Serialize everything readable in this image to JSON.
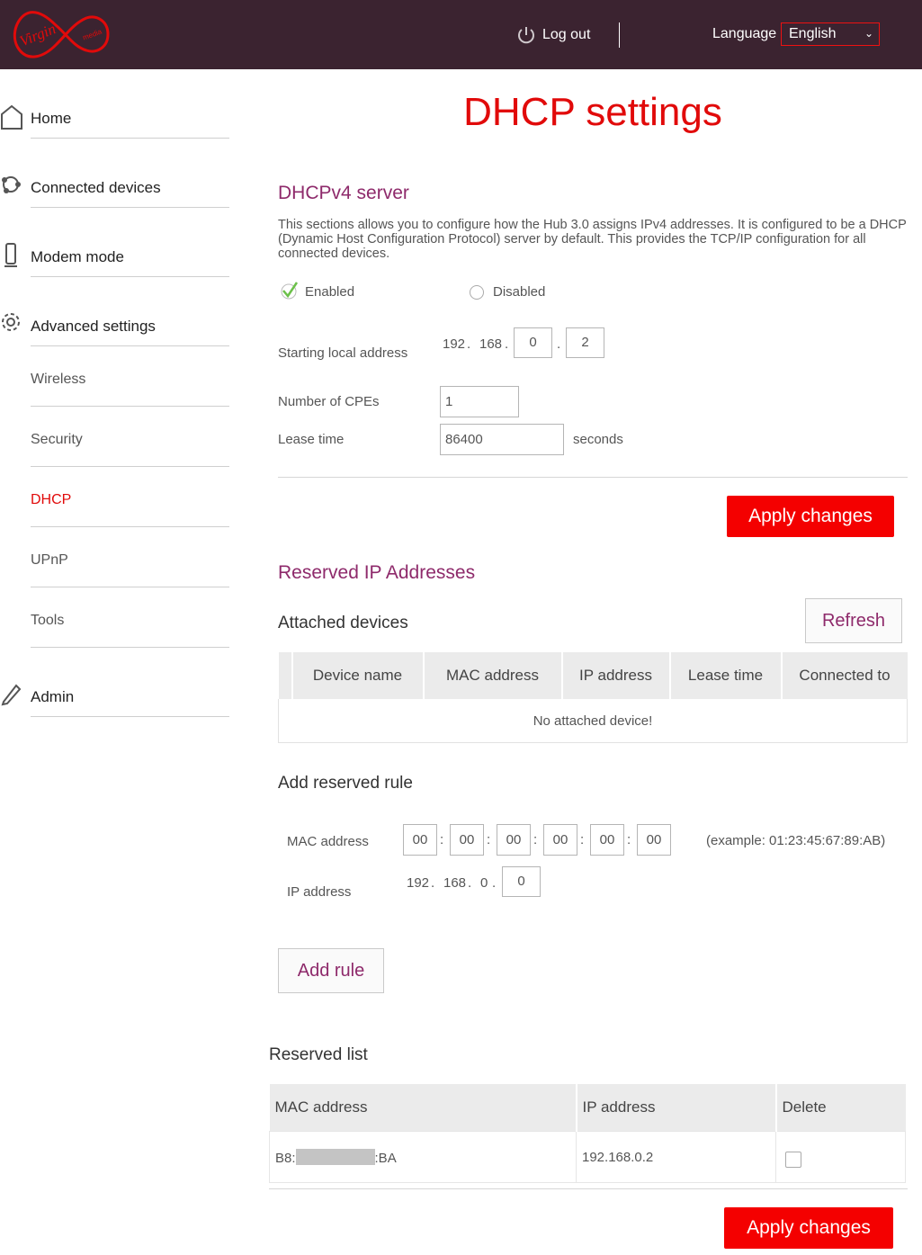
{
  "header": {
    "logo_text": "Virgin media",
    "logout_label": "Log out",
    "language_label": "Language",
    "language_value": "English"
  },
  "sidebar": {
    "items": [
      {
        "label": "Home",
        "icon": "home-icon"
      },
      {
        "label": "Connected devices",
        "icon": "devices-icon"
      },
      {
        "label": "Modem mode",
        "icon": "modem-icon"
      },
      {
        "label": "Advanced settings",
        "icon": "gear-icon"
      }
    ],
    "sub_items": [
      "Wireless",
      "Security",
      "DHCP",
      "UPnP",
      "Tools"
    ],
    "active_sub_item": "DHCP",
    "admin": {
      "label": "Admin",
      "icon": "pencil-icon"
    }
  },
  "page": {
    "title": "DHCP settings"
  },
  "dhcpv4": {
    "title": "DHCPv4 server",
    "description": "This sections allows you to configure how the Hub 3.0 assigns IPv4 addresses. It is configured to be a DHCP (Dynamic Host Configuration Protocol) server by default. This provides the TCP/IP configuration for all connected devices.",
    "enabled_label": "Enabled",
    "disabled_label": "Disabled",
    "selected": "Enabled",
    "start_label": "Starting local address",
    "start_octet1": "192",
    "start_octet2": "168",
    "start_octet3": "0",
    "start_octet4": "2",
    "cpe_label": "Number of CPEs",
    "cpe_value": "1",
    "lease_label": "Lease time",
    "lease_value": "86400",
    "lease_unit": "seconds",
    "apply_label": "Apply changes"
  },
  "reserved": {
    "title": "Reserved IP Addresses",
    "attached_title": "Attached devices",
    "refresh_label": "Refresh",
    "columns": [
      "Device name",
      "MAC address",
      "IP address",
      "Lease time",
      "Connected to"
    ],
    "empty_message": "No attached device!"
  },
  "add_rule": {
    "title": "Add reserved rule",
    "mac_label": "MAC address",
    "mac_octets": [
      "00",
      "00",
      "00",
      "00",
      "00",
      "00"
    ],
    "mac_example": "(example: 01:23:45:67:89:AB)",
    "ip_label": "IP address",
    "ip_octet1": "192",
    "ip_octet2": "168",
    "ip_octet3": "0",
    "ip_octet4": "0",
    "add_label": "Add rule"
  },
  "reserved_list": {
    "title": "Reserved list",
    "columns": [
      "MAC address",
      "IP address",
      "Delete"
    ],
    "rows": [
      {
        "mac_prefix": "B8:",
        "mac_suffix": ":BA",
        "ip": "192.168.0.2"
      }
    ],
    "apply_label": "Apply changes"
  },
  "colors": {
    "header_bg": "#3b2330",
    "brand_red": "#e10a0a",
    "button_red": "#f40000",
    "section_purple": "#8e2a6b",
    "check_green": "#6cc04a"
  }
}
